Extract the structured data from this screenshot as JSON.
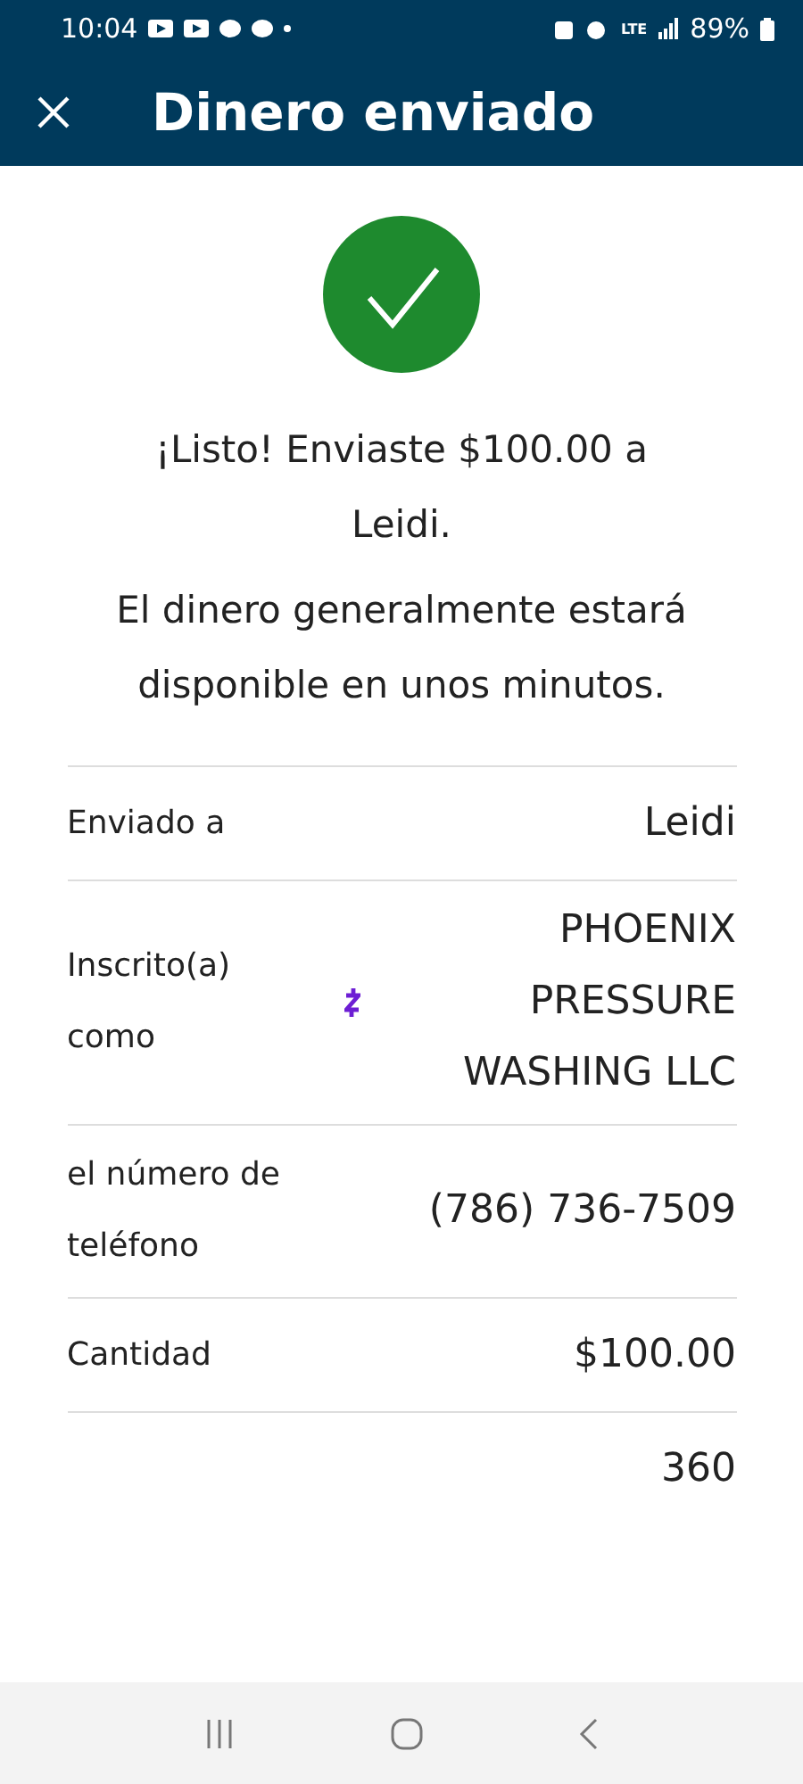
{
  "status_bar": {
    "time": "10:04",
    "network": "LTE",
    "battery": "89%"
  },
  "header": {
    "title": "Dinero enviado"
  },
  "message": {
    "headline": "¡Listo! Enviaste $100.00 a Leidi.",
    "note": "El dinero generalmente estará disponible en unos minutos."
  },
  "details": [
    {
      "label": "Enviado a",
      "value": "Leidi",
      "kind": "plain"
    },
    {
      "label": "Inscrito(a) como",
      "value": "PHOENIX PRESSURE WASHING LLC",
      "kind": "zelle"
    },
    {
      "label": "el número de teléfono",
      "value": "(786) 736-7509",
      "kind": "plain"
    },
    {
      "label": "Cantidad",
      "value": "$100.00",
      "kind": "plain"
    },
    {
      "value": "360",
      "kind": "plain"
    }
  ]
}
